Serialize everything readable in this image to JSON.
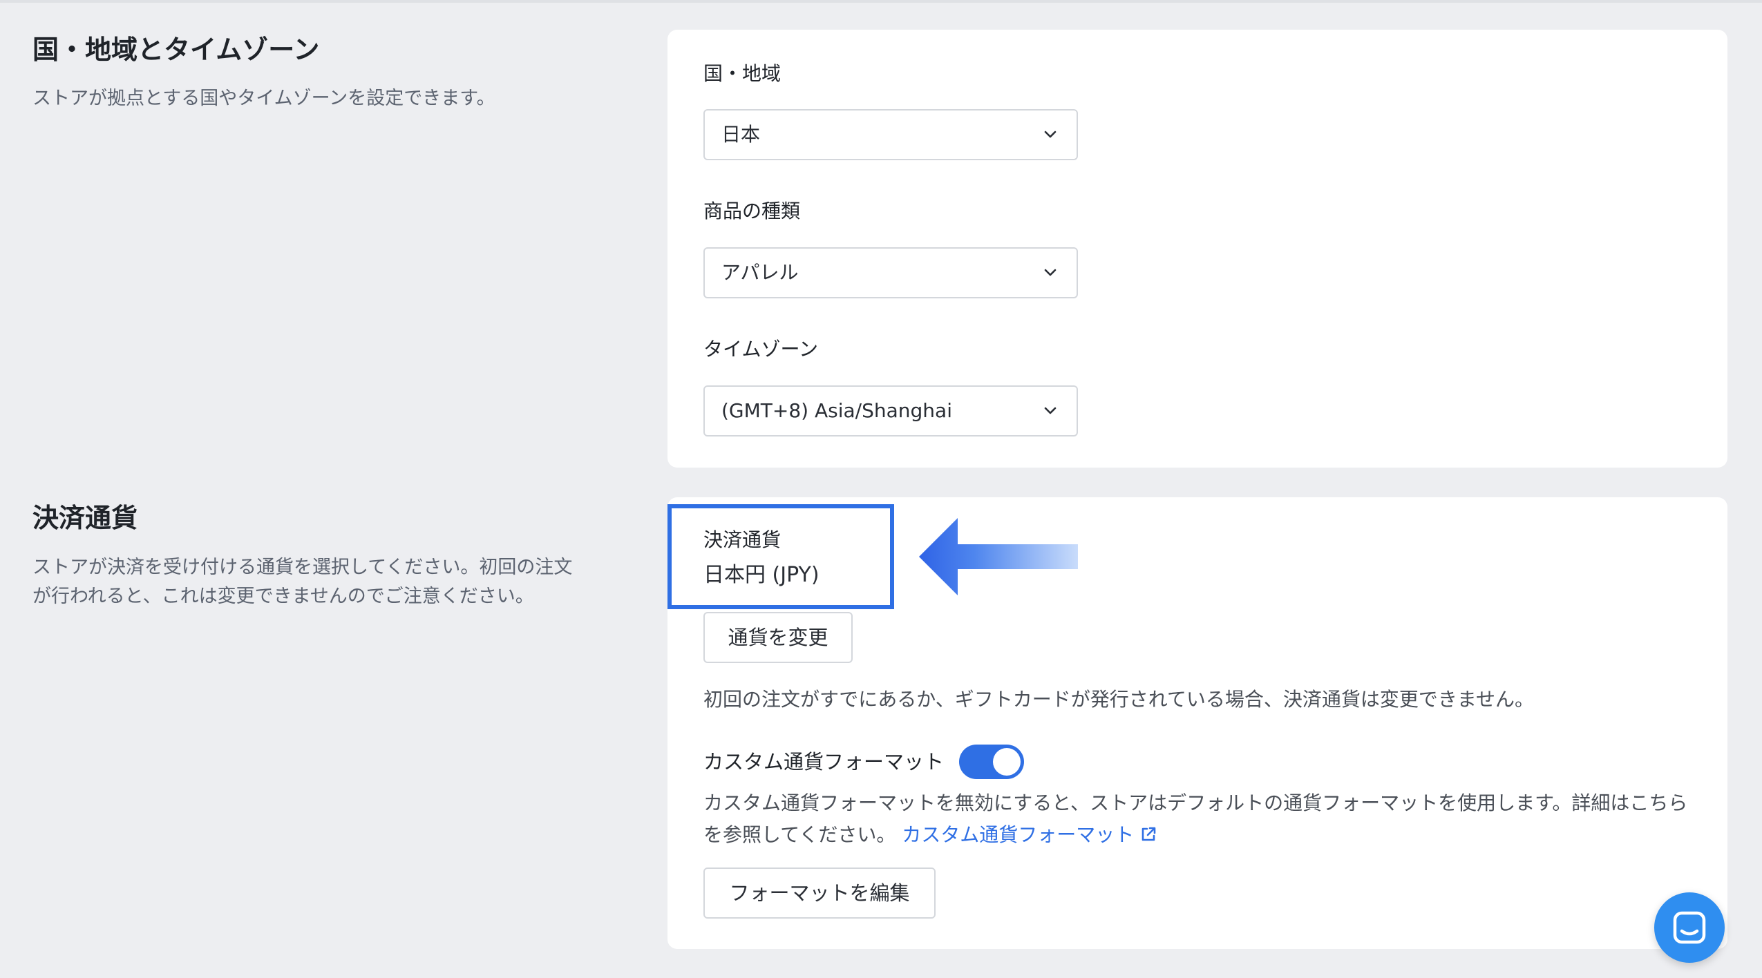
{
  "region_section": {
    "title": "国・地域とタイムゾーン",
    "description": "ストアが拠点とする国やタイムゾーンを設定できます。",
    "fields": [
      {
        "label": "国・地域",
        "value": "日本"
      },
      {
        "label": "商品の種類",
        "value": "アパレル"
      },
      {
        "label": "タイムゾーン",
        "value": "(GMT+8) Asia/Shanghai"
      }
    ]
  },
  "currency_section": {
    "title": "決済通貨",
    "description": "ストアが決済を受け付ける通貨を選択してください。初回の注文が行われると、これは変更できませんのでご注意ください。",
    "currency_label": "決済通貨",
    "currency_value": "日本円 (JPY)",
    "change_button": "通貨を変更",
    "note": "初回の注文がすでにあるか、ギフトカードが発行されている場合、決済通貨は変更できません。",
    "custom_format": {
      "label": "カスタム通貨フォーマット",
      "enabled": true,
      "description": "カスタム通貨フォーマットを無効にすると、ストアはデフォルトの通貨フォーマットを使用します。詳細はこちらを参照してください。",
      "link_text": "カスタム通貨フォーマット",
      "edit_button": "フォーマットを編集"
    }
  },
  "icons": {
    "chevron": "chevron-down-icon",
    "external_link": "external-link-icon",
    "chat": "chat-icon",
    "arrow": "arrow-left-icon"
  },
  "colors": {
    "accent": "#2f6fe4",
    "background": "#edeef1",
    "chat": "#2f8ef0"
  }
}
